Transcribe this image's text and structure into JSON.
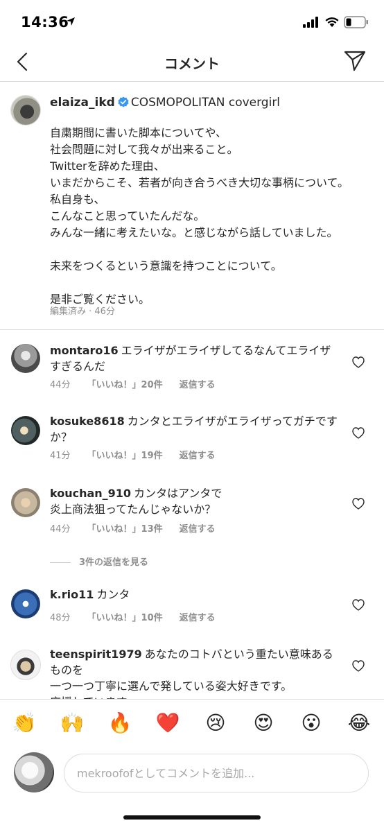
{
  "status_bar": {
    "time": "14:36"
  },
  "nav": {
    "title": "コメント"
  },
  "caption": {
    "username": "elaiza_ikd",
    "bio_title": "COSMOPOLITAN covergirl",
    "text": "自粛期間に書いた脚本についてや、\n社会問題に対して我々が出来ること。\nTwitterを辞めた理由、\nいまだからこそ、若者が向き合うべき大切な事柄について。\n私自身も、\nこんなこと思っていたんだな。\nみんな一緒に考えたいな。と感じながら話していました。\n\n未来をつくるという意識を持つことについて。\n\n是非ご覧ください。",
    "meta": "編集済み · 46分"
  },
  "comments": [
    {
      "username": "montaro16",
      "text": "エライザがエライザしてるなんてエライザすぎるんだ",
      "time": "44分",
      "likes": "「いいね！」20件",
      "reply": "返信する"
    },
    {
      "username": "kosuke8618",
      "text": "カンタとエライザがエライザってガチですか？",
      "time": "41分",
      "likes": "「いいね！」19件",
      "reply": "返信する"
    },
    {
      "username": "kouchan_910",
      "text": "カンタはアンタで\n炎上商法狙ってたんじゃないか？",
      "time": "44分",
      "likes": "「いいね！」13件",
      "reply": "返信する"
    },
    {
      "username": "k.rio11",
      "text": "カンタ",
      "time": "48分",
      "likes": "「いいね！」10件",
      "reply": "返信する"
    },
    {
      "username": "teenspirit1979",
      "text": "あなたのコトバという重たい意味あるものを\n一つ一つ丁寧に選んで発している姿大好きです。\n応援しています。",
      "time": "",
      "likes": "",
      "reply": ""
    }
  ],
  "view_replies": "3件の返信を見る",
  "emojis": [
    "👏",
    "🙌",
    "🔥",
    "❤️",
    "😢",
    "😍",
    "😮",
    "😂"
  ],
  "input": {
    "placeholder": "mekroofofとしてコメントを追加..."
  },
  "colors": {
    "verified": "#3897f0",
    "meta_text": "#8e8e8e",
    "divider": "#dbdbdb"
  }
}
